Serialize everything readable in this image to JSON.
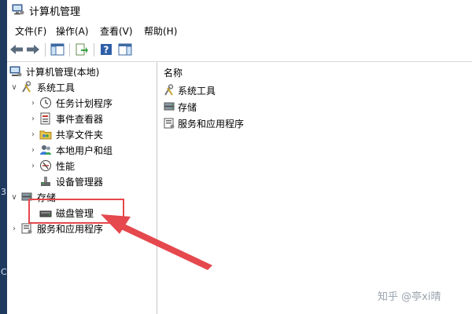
{
  "window": {
    "title": "计算机管理"
  },
  "menu": [
    {
      "label": "文件(F)"
    },
    {
      "label": "操作(A)"
    },
    {
      "label": "查看(V)"
    },
    {
      "label": "帮助(H)"
    }
  ],
  "toolbar": {
    "buttons": [
      {
        "icon": "back-arrow-icon"
      },
      {
        "icon": "forward-arrow-icon"
      },
      {
        "icon": "show-hide-console-tree-icon"
      },
      {
        "icon": "export-list-icon"
      },
      {
        "icon": "help-icon"
      },
      {
        "icon": "show-action-pane-icon"
      }
    ]
  },
  "tree": {
    "root": {
      "label": "计算机管理(本地)",
      "icon": "computer-management-icon"
    },
    "items": [
      {
        "label": "系统工具",
        "icon": "tools-icon",
        "state": "expanded"
      },
      {
        "label": "任务计划程序",
        "icon": "clock-icon",
        "state": "collapsed"
      },
      {
        "label": "事件查看器",
        "icon": "event-viewer-icon",
        "state": "collapsed"
      },
      {
        "label": "共享文件夹",
        "icon": "shared-folder-icon",
        "state": "collapsed"
      },
      {
        "label": "本地用户和组",
        "icon": "users-icon",
        "state": "collapsed"
      },
      {
        "label": "性能",
        "icon": "performance-icon",
        "state": "collapsed"
      },
      {
        "label": "设备管理器",
        "icon": "device-manager-icon",
        "state": "leaf"
      },
      {
        "label": "存储",
        "icon": "storage-icon",
        "state": "expanded"
      },
      {
        "label": "磁盘管理",
        "icon": "disk-icon",
        "state": "leaf"
      },
      {
        "label": "服务和应用程序",
        "icon": "services-icon",
        "state": "collapsed"
      }
    ]
  },
  "list": {
    "header": "名称",
    "items": [
      {
        "label": "系统工具",
        "icon": "tools-icon"
      },
      {
        "label": "存储",
        "icon": "storage-icon"
      },
      {
        "label": "服务和应用程序",
        "icon": "services-icon"
      }
    ]
  },
  "watermark": "知乎 @亭xi晴",
  "colors": {
    "annotation": "#e5484d",
    "selection_text": "#000000"
  }
}
